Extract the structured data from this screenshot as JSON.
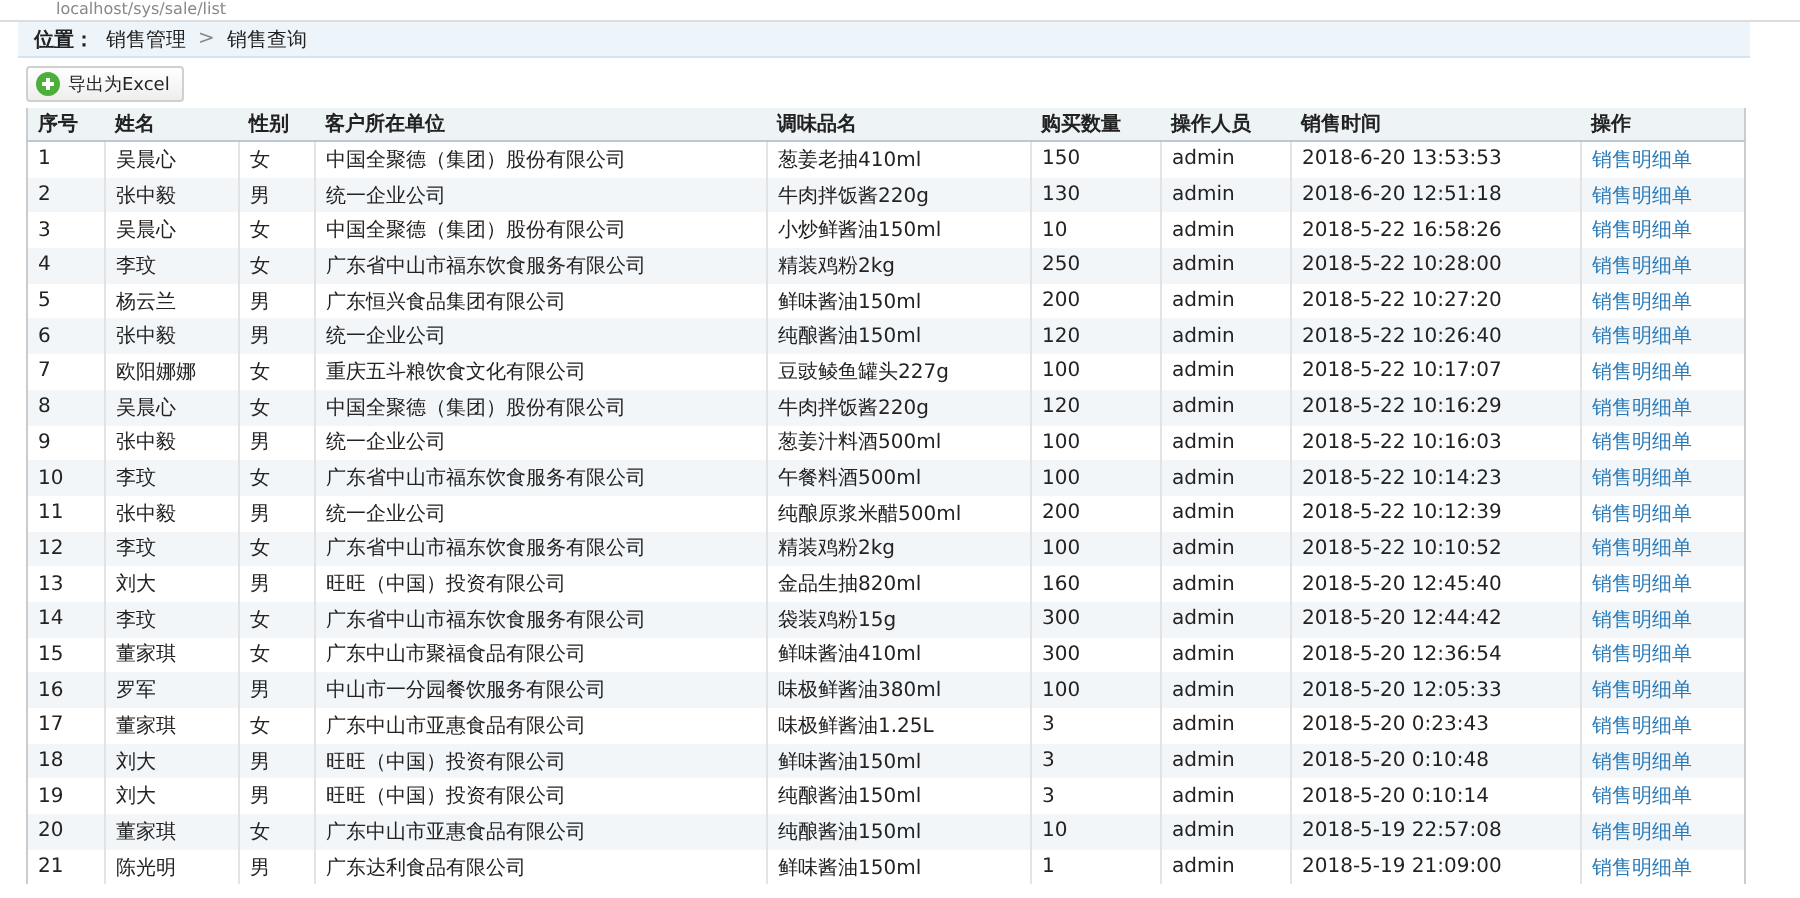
{
  "address_bar": {
    "url": "localhost/sys/sale/list"
  },
  "breadcrumb": {
    "label": "位置：",
    "items": [
      "销售管理",
      "销售查询"
    ],
    "separator": ">"
  },
  "toolbar": {
    "export_button": "导出为Excel"
  },
  "table": {
    "columns": [
      "序号",
      "姓名",
      "性别",
      "客户所在单位",
      "调味品名",
      "购买数量",
      "操作人员",
      "销售时间",
      "操作"
    ],
    "rows": [
      [
        "1",
        "吴晨心",
        "女",
        "中国全聚德（集团）股份有限公司",
        "葱姜老抽410ml",
        "150",
        "admin",
        "2018-6-20 13:53:53",
        "销售明细单"
      ],
      [
        "2",
        "张中毅",
        "男",
        "统一企业公司",
        "牛肉拌饭酱220g",
        "130",
        "admin",
        "2018-6-20 12:51:18",
        "销售明细单"
      ],
      [
        "3",
        "吴晨心",
        "女",
        "中国全聚德（集团）股份有限公司",
        "小炒鲜酱油150ml",
        "10",
        "admin",
        "2018-5-22 16:58:26",
        "销售明细单"
      ],
      [
        "4",
        "李玟",
        "女",
        "广东省中山市福东饮食服务有限公司",
        "精装鸡粉2kg",
        "250",
        "admin",
        "2018-5-22 10:28:00",
        "销售明细单"
      ],
      [
        "5",
        "杨云兰",
        "男",
        "广东恒兴食品集团有限公司",
        "鲜味酱油150ml",
        "200",
        "admin",
        "2018-5-22 10:27:20",
        "销售明细单"
      ],
      [
        "6",
        "张中毅",
        "男",
        "统一企业公司",
        "纯酿酱油150ml",
        "120",
        "admin",
        "2018-5-22 10:26:40",
        "销售明细单"
      ],
      [
        "7",
        "欧阳娜娜",
        "女",
        "重庆五斗粮饮食文化有限公司",
        "豆豉鲮鱼罐头227g",
        "100",
        "admin",
        "2018-5-22 10:17:07",
        "销售明细单"
      ],
      [
        "8",
        "吴晨心",
        "女",
        "中国全聚德（集团）股份有限公司",
        "牛肉拌饭酱220g",
        "120",
        "admin",
        "2018-5-22 10:16:29",
        "销售明细单"
      ],
      [
        "9",
        "张中毅",
        "男",
        "统一企业公司",
        "葱姜汁料酒500ml",
        "100",
        "admin",
        "2018-5-22 10:16:03",
        "销售明细单"
      ],
      [
        "10",
        "李玟",
        "女",
        "广东省中山市福东饮食服务有限公司",
        "午餐料酒500ml",
        "100",
        "admin",
        "2018-5-22 10:14:23",
        "销售明细单"
      ],
      [
        "11",
        "张中毅",
        "男",
        "统一企业公司",
        "纯酿原浆米醋500ml",
        "200",
        "admin",
        "2018-5-22 10:12:39",
        "销售明细单"
      ],
      [
        "12",
        "李玟",
        "女",
        "广东省中山市福东饮食服务有限公司",
        "精装鸡粉2kg",
        "100",
        "admin",
        "2018-5-22 10:10:52",
        "销售明细单"
      ],
      [
        "13",
        "刘大",
        "男",
        "旺旺（中国）投资有限公司",
        "金品生抽820ml",
        "160",
        "admin",
        "2018-5-20 12:45:40",
        "销售明细单"
      ],
      [
        "14",
        "李玟",
        "女",
        "广东省中山市福东饮食服务有限公司",
        "袋装鸡粉15g",
        "300",
        "admin",
        "2018-5-20 12:44:42",
        "销售明细单"
      ],
      [
        "15",
        "董家琪",
        "女",
        "广东中山市聚福食品有限公司",
        "鲜味酱油410ml",
        "300",
        "admin",
        "2018-5-20 12:36:54",
        "销售明细单"
      ],
      [
        "16",
        "罗军",
        "男",
        "中山市一分园餐饮服务有限公司",
        "味极鲜酱油380ml",
        "100",
        "admin",
        "2018-5-20 12:05:33",
        "销售明细单"
      ],
      [
        "17",
        "董家琪",
        "女",
        "广东中山市亚惠食品有限公司",
        "味极鲜酱油1.25L",
        "3",
        "admin",
        "2018-5-20 0:23:43",
        "销售明细单"
      ],
      [
        "18",
        "刘大",
        "男",
        "旺旺（中国）投资有限公司",
        "鲜味酱油150ml",
        "3",
        "admin",
        "2018-5-20 0:10:48",
        "销售明细单"
      ],
      [
        "19",
        "刘大",
        "男",
        "旺旺（中国）投资有限公司",
        "纯酿酱油150ml",
        "3",
        "admin",
        "2018-5-20 0:10:14",
        "销售明细单"
      ],
      [
        "20",
        "董家琪",
        "女",
        "广东中山市亚惠食品有限公司",
        "纯酿酱油150ml",
        "10",
        "admin",
        "2018-5-19 22:57:08",
        "销售明细单"
      ],
      [
        "21",
        "陈光明",
        "男",
        "广东达利食品有限公司",
        "鲜味酱油150ml",
        "1",
        "admin",
        "2018-5-19 21:09:00",
        "销售明细单"
      ]
    ]
  }
}
